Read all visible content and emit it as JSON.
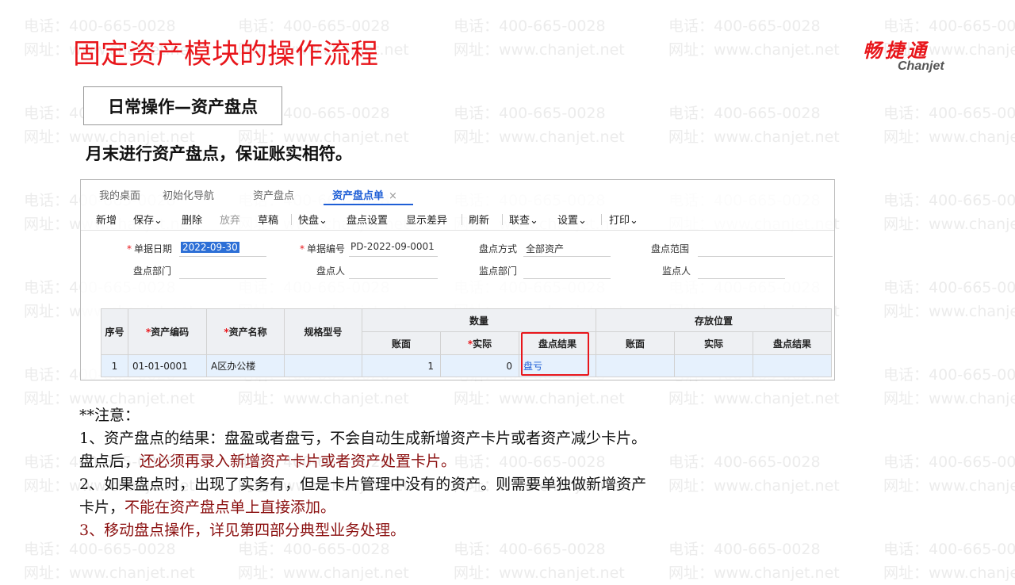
{
  "watermark": {
    "phone": "电话：400-665-0028",
    "site": "网址：www.chanjet.net"
  },
  "slide": {
    "title": "固定资产模块的操作流程",
    "logo_cn": "畅捷通",
    "logo_en": "Chanjet",
    "section_label": "日常操作—资产盘点",
    "subtitle": "月末进行资产盘点，保证账实相符。"
  },
  "app": {
    "tabs": [
      "我的桌面",
      "初始化导航",
      "资产盘点",
      "资产盘点单"
    ],
    "active_tab": 3,
    "close_glyph": "×",
    "toolbar": {
      "new": "新增",
      "save": "保存",
      "delete": "删除",
      "discard": "放弃",
      "draft": "草稿",
      "quick": "快盘",
      "count_settings": "盘点设置",
      "show_diff": "显示差异",
      "refresh": "刷新",
      "link": "联查",
      "settings": "设置",
      "print": "打印",
      "dropdown_glyph": "⌄"
    },
    "form": {
      "doc_date_label": "单据日期",
      "doc_date_value": "2022-09-30",
      "doc_no_label": "单据编号",
      "doc_no_value": "PD-2022-09-0001",
      "method_label": "盘点方式",
      "method_value": "全部资产",
      "range_label": "盘点范围",
      "range_value": "",
      "dept_label": "盘点部门",
      "dept_value": "",
      "person_label": "盘点人",
      "person_value": "",
      "supervise_dept_label": "监点部门",
      "supervise_dept_value": "",
      "supervisor_label": "监点人",
      "supervisor_value": ""
    },
    "table": {
      "headers": {
        "seq": "序号",
        "code": "资产编码",
        "name": "资产名称",
        "spec": "规格型号",
        "qty_group": "数量",
        "qty_book": "账面",
        "qty_actual": "实际",
        "qty_result": "盘点结果",
        "loc_group": "存放位置",
        "loc_book": "账面",
        "loc_actual": "实际",
        "loc_result": "盘点结果"
      },
      "rows": [
        {
          "seq": "1",
          "code": "01-01-0001",
          "name": "A区办公楼",
          "spec": "",
          "qty_book": "1",
          "qty_actual": "0",
          "qty_result": "盘亏",
          "loc_book": "",
          "loc_actual": "",
          "loc_result": ""
        }
      ]
    }
  },
  "notes": {
    "heading": "**注意：",
    "line1": "1、资产盘点的结果：盘盈或者盘亏，不会自动生成新增资产卡片或者资产减少卡片。",
    "line2_a": "盘点后，",
    "line2_b": "还必须再录入新增资产卡片或者资产处置卡片。",
    "line3": "2、如果盘点时，出现了实务有，但是卡片管理中没有的资产。则需要单独做新增资产",
    "line4_a": "卡片，",
    "line4_b": "不能在资产盘点单上直接添加。",
    "line5": "3、移动盘点操作，详见第四部分典型业务处理。"
  },
  "colors": {
    "title_red": "#e8161b",
    "accent_blue": "#1f5fd6",
    "note_red": "#8b1010"
  }
}
